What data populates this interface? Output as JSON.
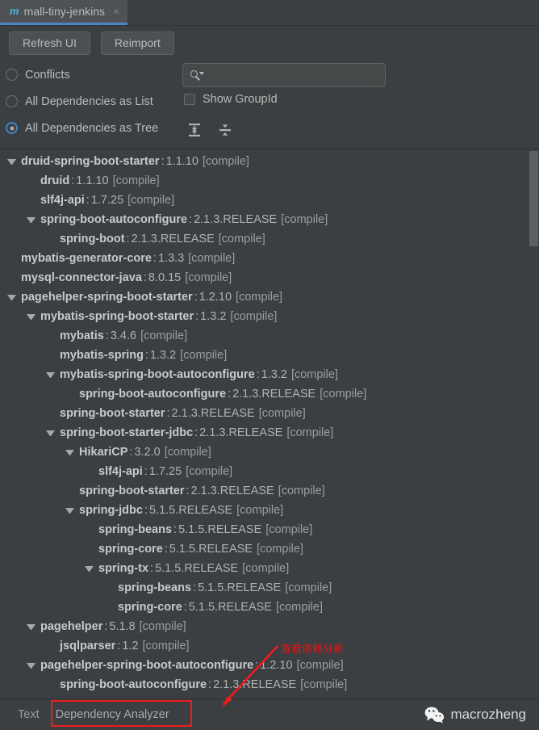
{
  "tab": {
    "icon": "maven-m-icon",
    "title": "mall-tiny-jenkins",
    "close": "×"
  },
  "toolbar": {
    "refresh_label": "Refresh UI",
    "reimport_label": "Reimport"
  },
  "options": {
    "conflicts_label": "Conflicts",
    "list_label": "All Dependencies as List",
    "tree_label": "All Dependencies as Tree",
    "show_groupid_label": "Show GroupId",
    "selected": "All Dependencies as Tree",
    "show_groupid_checked": false,
    "expand_all_icon": "expand-all-icon",
    "collapse_all_icon": "collapse-all-icon"
  },
  "search": {
    "value": "",
    "placeholder": "",
    "icon": "search-icon",
    "caret_icon": "chevron-down-icon"
  },
  "tree": {
    "rows": [
      {
        "indent": 0,
        "expandable": true,
        "artifact": "druid-spring-boot-starter",
        "version": "1.1.10",
        "scope": "[compile]"
      },
      {
        "indent": 1,
        "expandable": false,
        "artifact": "druid",
        "version": "1.1.10",
        "scope": "[compile]"
      },
      {
        "indent": 1,
        "expandable": false,
        "artifact": "slf4j-api",
        "version": "1.7.25",
        "scope": "[compile]"
      },
      {
        "indent": 1,
        "expandable": true,
        "artifact": "spring-boot-autoconfigure",
        "version": "2.1.3.RELEASE",
        "scope": "[compile]"
      },
      {
        "indent": 2,
        "expandable": false,
        "artifact": "spring-boot",
        "version": "2.1.3.RELEASE",
        "scope": "[compile]"
      },
      {
        "indent": 0,
        "expandable": false,
        "artifact": "mybatis-generator-core",
        "version": "1.3.3",
        "scope": "[compile]"
      },
      {
        "indent": 0,
        "expandable": false,
        "artifact": "mysql-connector-java",
        "version": "8.0.15",
        "scope": "[compile]"
      },
      {
        "indent": 0,
        "expandable": true,
        "artifact": "pagehelper-spring-boot-starter",
        "version": "1.2.10",
        "scope": "[compile]"
      },
      {
        "indent": 1,
        "expandable": true,
        "artifact": "mybatis-spring-boot-starter",
        "version": "1.3.2",
        "scope": "[compile]"
      },
      {
        "indent": 2,
        "expandable": false,
        "artifact": "mybatis",
        "version": "3.4.6",
        "scope": "[compile]"
      },
      {
        "indent": 2,
        "expandable": false,
        "artifact": "mybatis-spring",
        "version": "1.3.2",
        "scope": "[compile]"
      },
      {
        "indent": 2,
        "expandable": true,
        "artifact": "mybatis-spring-boot-autoconfigure",
        "version": "1.3.2",
        "scope": "[compile]"
      },
      {
        "indent": 3,
        "expandable": false,
        "artifact": "spring-boot-autoconfigure",
        "version": "2.1.3.RELEASE",
        "scope": "[compile]"
      },
      {
        "indent": 2,
        "expandable": false,
        "artifact": "spring-boot-starter",
        "version": "2.1.3.RELEASE",
        "scope": "[compile]"
      },
      {
        "indent": 2,
        "expandable": true,
        "artifact": "spring-boot-starter-jdbc",
        "version": "2.1.3.RELEASE",
        "scope": "[compile]"
      },
      {
        "indent": 3,
        "expandable": true,
        "artifact": "HikariCP",
        "version": "3.2.0",
        "scope": "[compile]"
      },
      {
        "indent": 4,
        "expandable": false,
        "artifact": "slf4j-api",
        "version": "1.7.25",
        "scope": "[compile]"
      },
      {
        "indent": 3,
        "expandable": false,
        "artifact": "spring-boot-starter",
        "version": "2.1.3.RELEASE",
        "scope": "[compile]"
      },
      {
        "indent": 3,
        "expandable": true,
        "artifact": "spring-jdbc",
        "version": "5.1.5.RELEASE",
        "scope": "[compile]"
      },
      {
        "indent": 4,
        "expandable": false,
        "artifact": "spring-beans",
        "version": "5.1.5.RELEASE",
        "scope": "[compile]"
      },
      {
        "indent": 4,
        "expandable": false,
        "artifact": "spring-core",
        "version": "5.1.5.RELEASE",
        "scope": "[compile]"
      },
      {
        "indent": 4,
        "expandable": true,
        "artifact": "spring-tx",
        "version": "5.1.5.RELEASE",
        "scope": "[compile]"
      },
      {
        "indent": 5,
        "expandable": false,
        "artifact": "spring-beans",
        "version": "5.1.5.RELEASE",
        "scope": "[compile]"
      },
      {
        "indent": 5,
        "expandable": false,
        "artifact": "spring-core",
        "version": "5.1.5.RELEASE",
        "scope": "[compile]"
      },
      {
        "indent": 1,
        "expandable": true,
        "artifact": "pagehelper",
        "version": "5.1.8",
        "scope": "[compile]"
      },
      {
        "indent": 2,
        "expandable": false,
        "artifact": "jsqlparser",
        "version": "1.2",
        "scope": "[compile]"
      },
      {
        "indent": 1,
        "expandable": true,
        "artifact": "pagehelper-spring-boot-autoconfigure",
        "version": "1.2.10",
        "scope": "[compile]"
      },
      {
        "indent": 2,
        "expandable": false,
        "artifact": "spring-boot-autoconfigure",
        "version": "2.1.3.RELEASE",
        "scope": "[compile]"
      }
    ]
  },
  "bottom": {
    "tabs": [
      {
        "label": "Text",
        "active": false
      },
      {
        "label": "Dependency Analyzer",
        "active": true
      }
    ]
  },
  "annotation": {
    "text": "查看依赖分析",
    "color": "#e81212"
  },
  "watermark": {
    "name": "macrozheng",
    "icon": "wechat-icon"
  },
  "colors": {
    "background": "#3c3f41",
    "tab_accent": "#4a88c7",
    "radio_accent": "#3d83c4",
    "annotation_red": "#e81212",
    "text": "#bbbbbb",
    "artifact_text": "#c7c9cb"
  }
}
